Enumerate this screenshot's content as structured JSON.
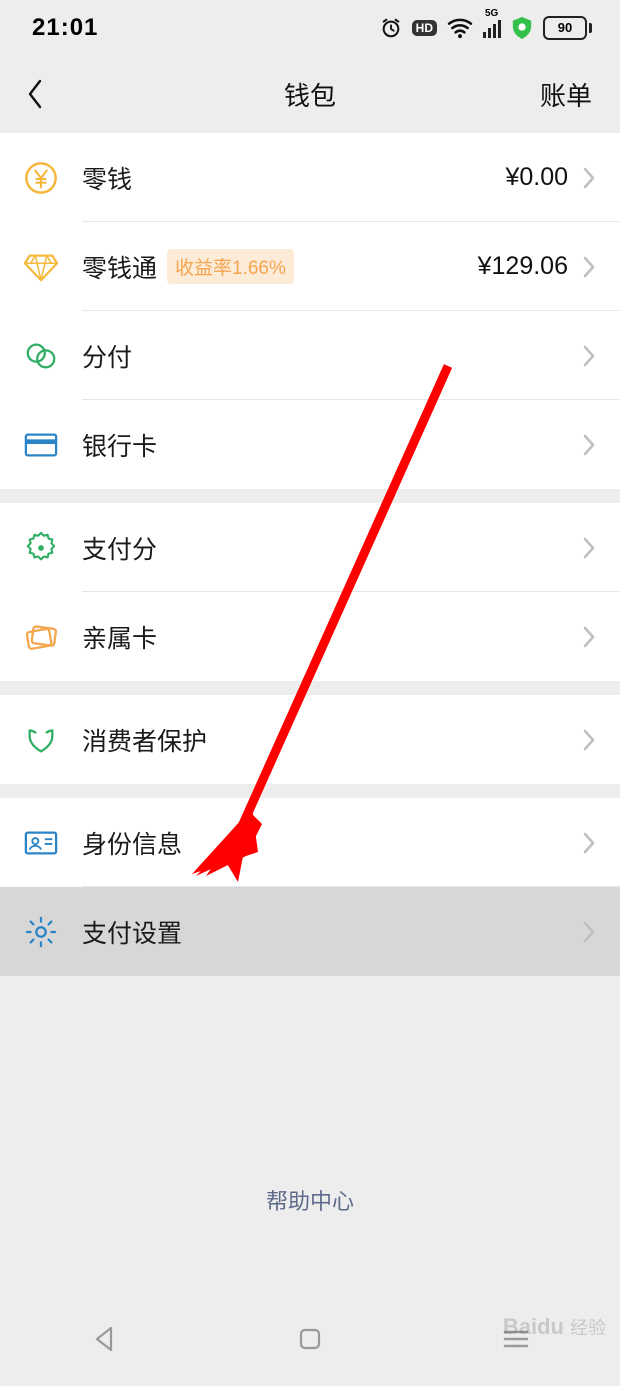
{
  "status": {
    "time": "21:01",
    "network_label": "5G",
    "battery": "90"
  },
  "header": {
    "title": "钱包",
    "right": "账单"
  },
  "rows": {
    "balance": {
      "label": "零钱",
      "value": "¥0.00"
    },
    "lqt": {
      "label": "零钱通",
      "badge": "收益率1.66%",
      "value": "¥129.06"
    },
    "fenfu": {
      "label": "分付"
    },
    "bank": {
      "label": "银行卡"
    },
    "payscore": {
      "label": "支付分"
    },
    "family": {
      "label": "亲属卡"
    },
    "consumer": {
      "label": "消费者保护"
    },
    "identity": {
      "label": "身份信息"
    },
    "settings": {
      "label": "支付设置"
    }
  },
  "footer": {
    "help": "帮助中心"
  },
  "watermark": {
    "brand": "Baidu",
    "sub": "经验"
  }
}
